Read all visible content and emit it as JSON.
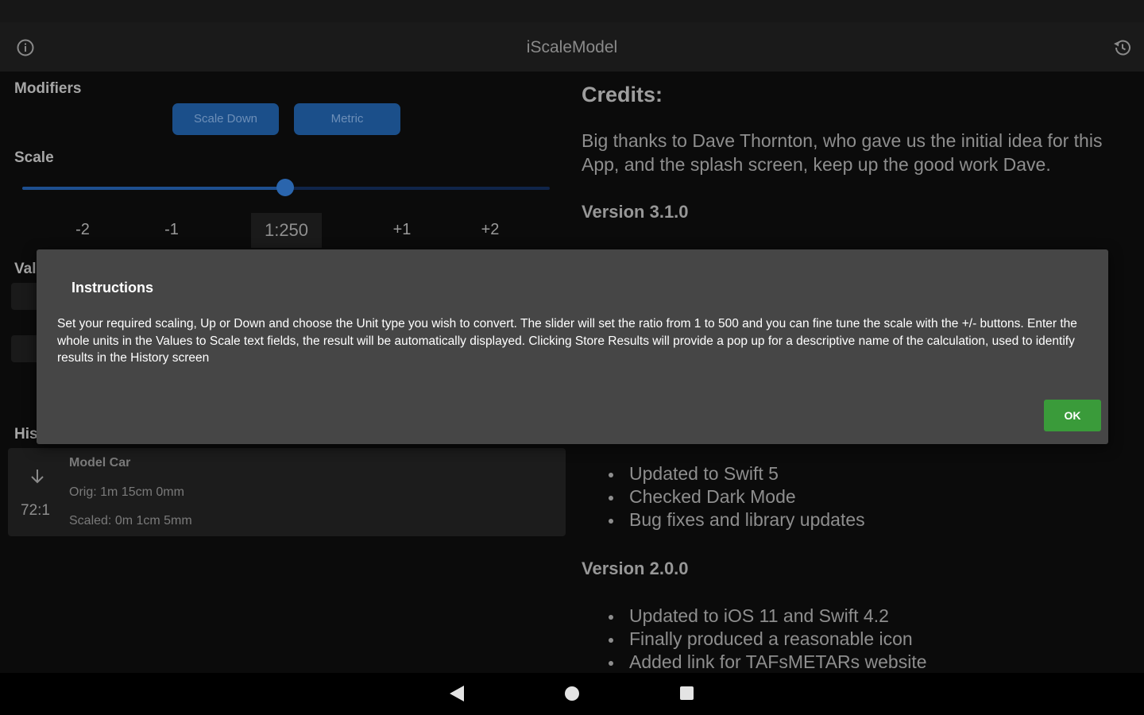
{
  "app": {
    "title": "iScaleModel"
  },
  "modifiers": {
    "label": "Modifiers",
    "scale_down_label": "Scale Down",
    "metric_label": "Metric"
  },
  "scale": {
    "label": "Scale",
    "slider_min": 1,
    "slider_max": 500,
    "slider_value": 250,
    "steps": [
      "-2",
      "-1",
      "+1",
      "+2"
    ],
    "current": "1:250"
  },
  "values": {
    "label_partial": "Val"
  },
  "history": {
    "label_partial": "His",
    "item": {
      "name": "Model Car",
      "orig": "Orig: 1m 15cm 0mm",
      "scaled": "Scaled: 0m 1cm 5mm",
      "ratio": "72:1"
    }
  },
  "credits": {
    "title": "Credits:",
    "text": "Big thanks to Dave Thornton, who gave us the initial idea for this App, and the splash screen, keep up the good work Dave.",
    "version_310": "Version 3.1.0",
    "list_a": [
      "Updated to Swift 5",
      "Checked Dark Mode",
      "Bug fixes and library updates"
    ],
    "version_200": "Version 2.0.0",
    "list_b": [
      "Updated to iOS 11 and Swift 4.2",
      "Finally produced a reasonable icon",
      "Added link for TAFsMETARs website"
    ]
  },
  "dialog": {
    "title": "Instructions",
    "body": "Set your required scaling, Up or Down and choose the Unit type you wish to convert. The slider will set the ratio from 1 to 500 and you can fine tune the scale with the +/- buttons. Enter the whole units in the Values to Scale text fields, the result will be automatically displayed. Clicking Store Results will provide a pop up for a descriptive name of the calculation, used to identify results in the History screen",
    "ok_label": "OK"
  },
  "colors": {
    "accent_blue": "#1b4f8a",
    "ok_green": "#3a9b3a",
    "dialog_bg": "#464646"
  },
  "icons": {
    "info": "info-icon",
    "history": "history-icon",
    "down_arrow": "arrow-down-icon",
    "nav_back": "back-icon",
    "nav_home": "home-icon",
    "nav_recents": "recents-icon"
  }
}
